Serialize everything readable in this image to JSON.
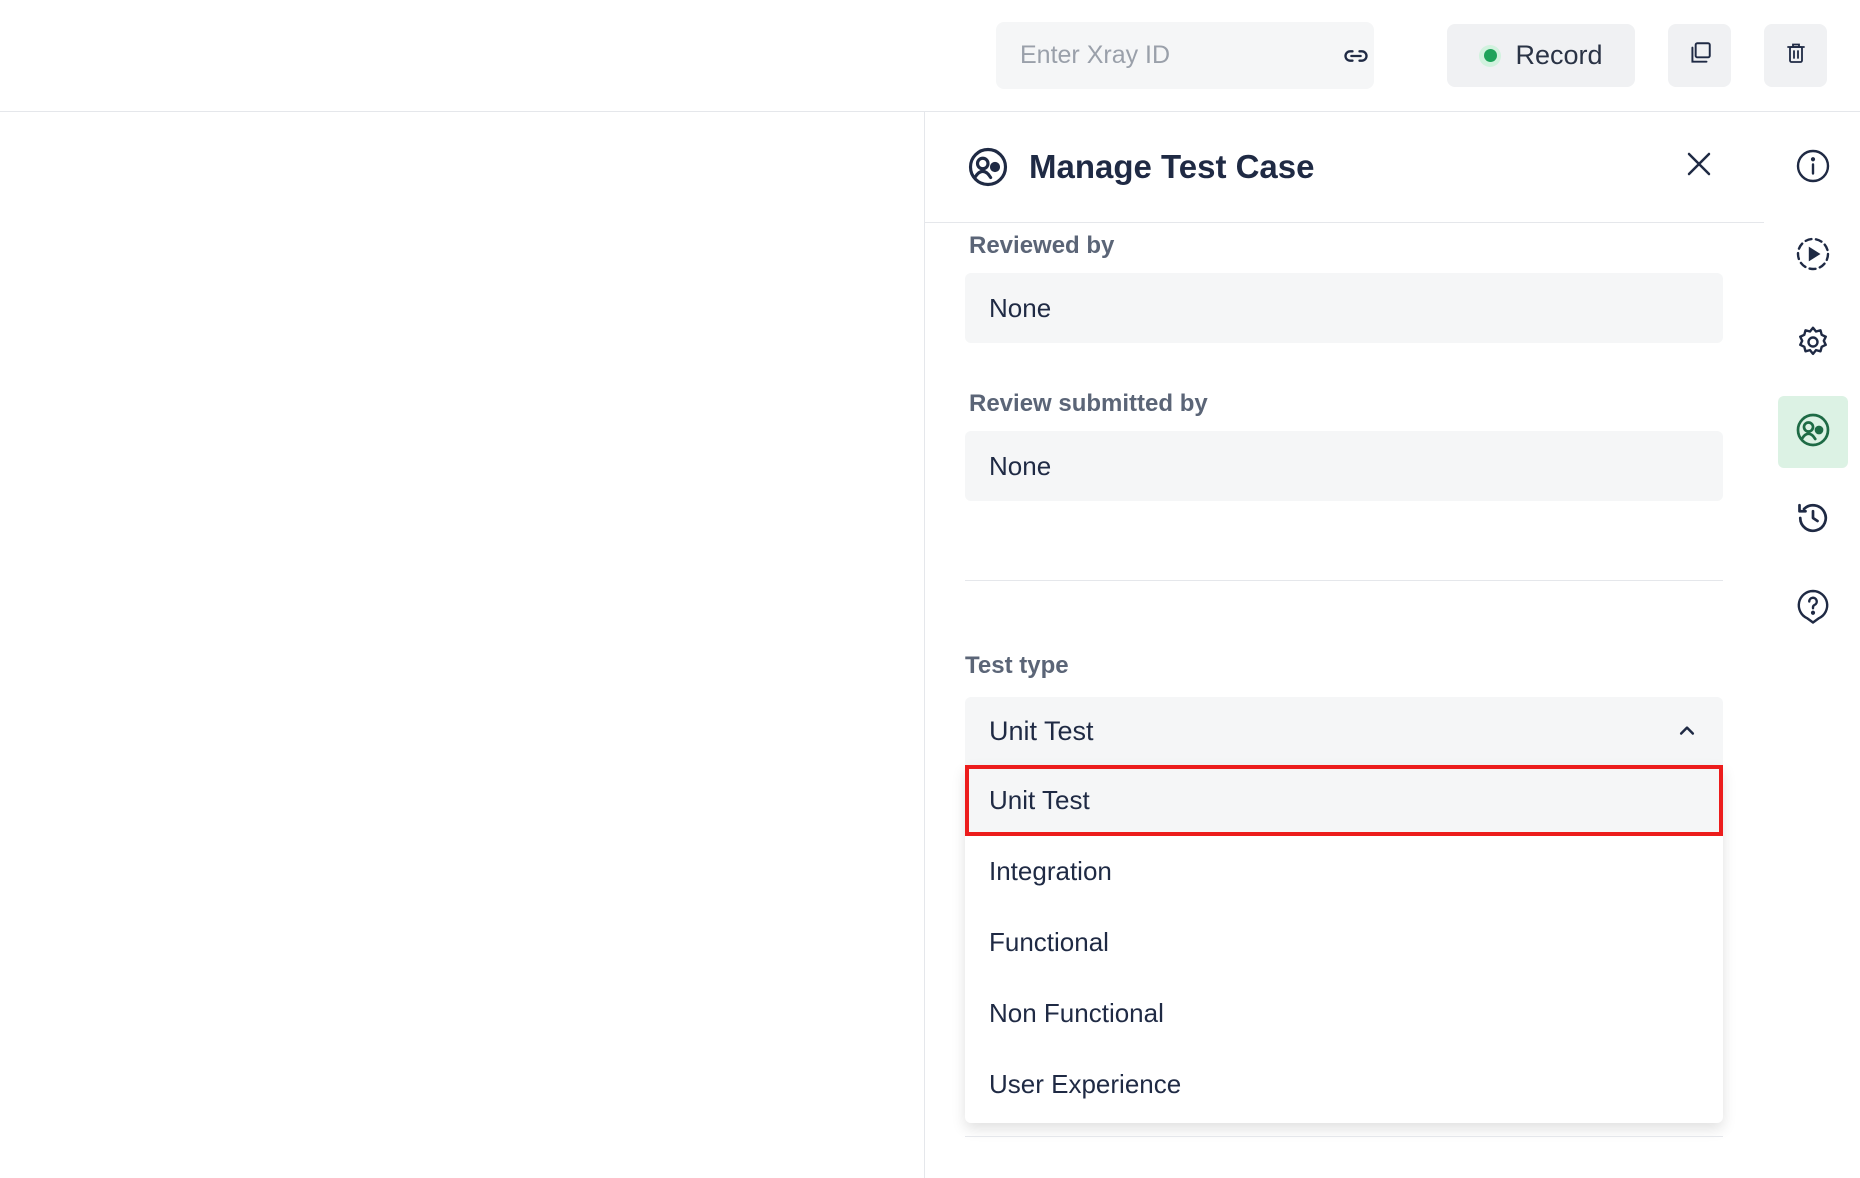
{
  "topbar": {
    "xray_placeholder": "Enter Xray ID",
    "record_label": "Record",
    "record_color": "#1ea35a"
  },
  "panel": {
    "title": "Manage Test Case",
    "reviewed_by_label": "Reviewed by",
    "reviewed_by_value": "None",
    "review_submitted_label": "Review submitted by",
    "review_submitted_value": "None",
    "test_type_label": "Test type",
    "test_type_value": "Unit Test",
    "test_type_options": [
      "Unit Test",
      "Integration",
      "Functional",
      "Non Functional",
      "User Experience"
    ]
  },
  "rail": {
    "items": [
      "info-icon",
      "play-circle-icon",
      "settings-icon",
      "manage-test-case-icon",
      "history-icon",
      "help-icon"
    ],
    "active": "manage-test-case-icon",
    "active_color": "#dcf2e4"
  }
}
